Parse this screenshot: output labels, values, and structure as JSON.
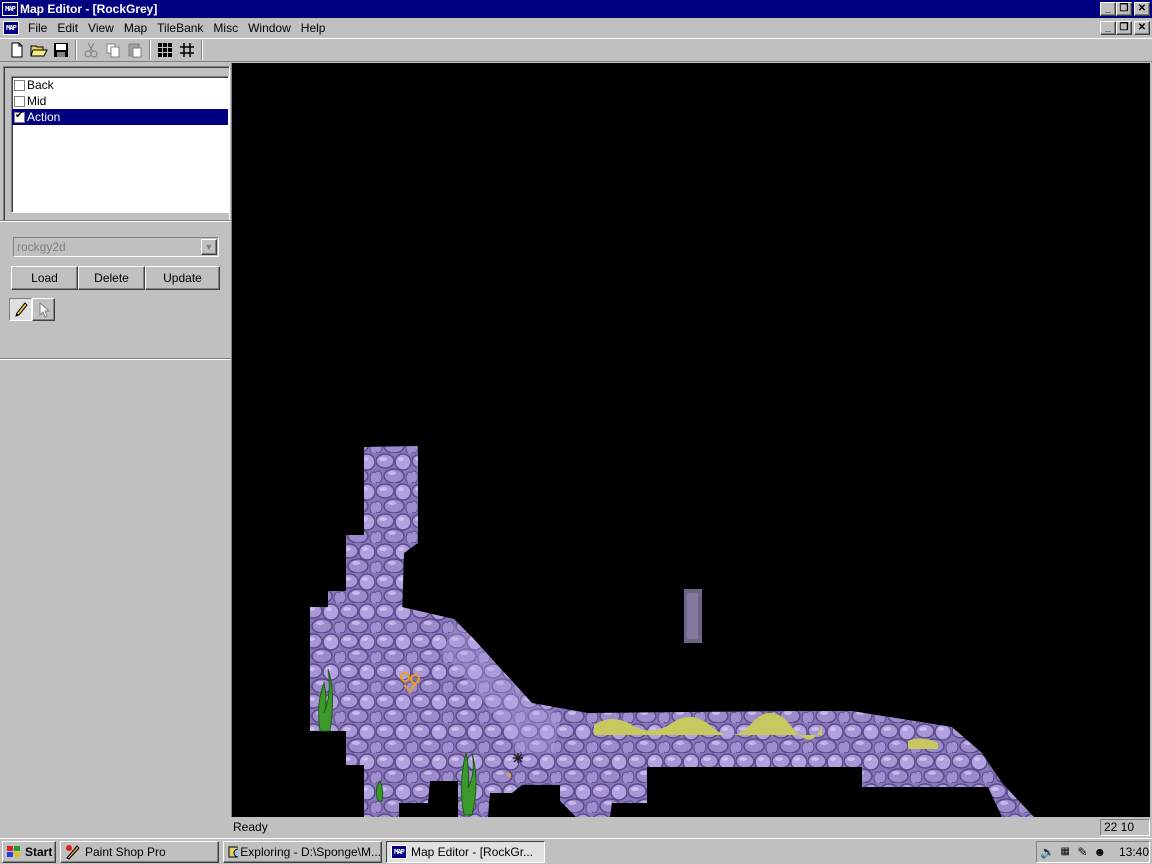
{
  "titlebar": {
    "icon_text": "MAP",
    "title": "Map Editor - [RockGrey]",
    "minimize": "_",
    "restore": "❐",
    "close": "✕"
  },
  "menubar": {
    "items": [
      {
        "label": "File"
      },
      {
        "label": "Edit"
      },
      {
        "label": "View"
      },
      {
        "label": "Map"
      },
      {
        "label": "TileBank"
      },
      {
        "label": "Misc"
      },
      {
        "label": "Window"
      },
      {
        "label": "Help"
      }
    ]
  },
  "toolbar": {
    "buttons": [
      "new-file-icon",
      "open-folder-icon",
      "save-icon",
      "cut-icon",
      "copy-icon",
      "paste-icon",
      "grid-tiles-icon",
      "grid-lines-icon"
    ]
  },
  "layers": {
    "items": [
      {
        "label": "Back",
        "checked": false,
        "selected": false
      },
      {
        "label": "Mid",
        "checked": false,
        "selected": false
      },
      {
        "label": "Action",
        "checked": true,
        "selected": true
      }
    ]
  },
  "tilebank": {
    "selected": "rockgy2d",
    "load_label": "Load",
    "delete_label": "Delete",
    "update_label": "Update"
  },
  "tools": [
    "pencil-icon",
    "pointer-icon"
  ],
  "status": {
    "text": "Ready",
    "coords": "22 10"
  },
  "taskbar": {
    "start_label": "Start",
    "tasks": [
      {
        "label": "Paint Shop Pro",
        "icon": "paint-shop-icon",
        "active": false
      },
      {
        "label": "Exploring - D:\\Sponge\\M...",
        "icon": "explorer-icon",
        "active": false
      },
      {
        "label": "Map Editor - [RockGr...",
        "icon": "map-editor-icon",
        "active": true
      }
    ],
    "clock": "13:40"
  },
  "colors": {
    "title_bar": "#000080",
    "rock_base": "#9b86c9",
    "rock_dark": "#6a5a9a",
    "rock_light": "#c8b8ee",
    "seaweed": "#3a8a2a",
    "moss": "#c8c860",
    "canvas": "#000000"
  }
}
